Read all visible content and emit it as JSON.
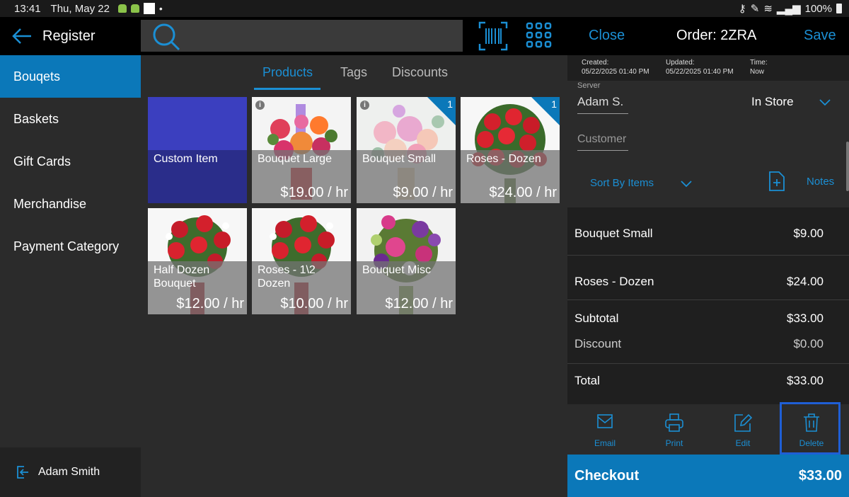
{
  "status": {
    "time": "13:41",
    "date": "Thu, May 22",
    "battery": "100%"
  },
  "header": {
    "back_label": "Register",
    "close": "Close",
    "order": "Order: 2ZRA",
    "save": "Save"
  },
  "sidebar": {
    "items": [
      {
        "label": "Bouqets"
      },
      {
        "label": "Baskets"
      },
      {
        "label": "Gift Cards"
      },
      {
        "label": "Merchandise"
      },
      {
        "label": "Payment Category"
      }
    ],
    "active_index": 0,
    "user": "Adam Smith"
  },
  "tabs": {
    "products": "Products",
    "tags": "Tags",
    "discounts": "Discounts"
  },
  "products": [
    {
      "name": "Custom Item",
      "price": ""
    },
    {
      "name": "Bouquet Large",
      "price": "$19.00 / hr",
      "info": "i"
    },
    {
      "name": "Bouquet Small",
      "price": "$9.00 / hr",
      "info": "i",
      "count": "1"
    },
    {
      "name": "Roses - Dozen",
      "price": "$24.00 / hr",
      "count": "1"
    },
    {
      "name": "Half Dozen Bouquet",
      "price": "$12.00 / hr"
    },
    {
      "name": "Roses - 1\\2 Dozen",
      "price": "$10.00 / hr"
    },
    {
      "name": "Bouquet Misc",
      "price": "$12.00 / hr"
    }
  ],
  "order": {
    "created_label": "Created:",
    "created": "05/22/2025 01:40 PM",
    "updated_label": "Updated:",
    "updated": "05/22/2025 01:40 PM",
    "time_label": "Time:",
    "time": "Now",
    "server_label": "Server",
    "server": "Adam S.",
    "type": "In Store",
    "customer_placeholder": "Customer",
    "sort": "Sort By Items",
    "notes": "Notes",
    "lines": [
      {
        "name": "Bouquet Small",
        "amount": "$9.00"
      },
      {
        "name": "Roses - Dozen",
        "amount": "$24.00"
      }
    ],
    "subtotal_label": "Subtotal",
    "subtotal": "$33.00",
    "discount_label": "Discount",
    "discount": "$0.00",
    "total_label": "Total",
    "total": "$33.00"
  },
  "actions": {
    "email": "Email",
    "print": "Print",
    "edit": "Edit",
    "delete": "Delete"
  },
  "checkout": {
    "label": "Checkout",
    "amount": "$33.00"
  },
  "colors": {
    "accent": "#1b8fd4",
    "active": "#0b78b9",
    "highlight": "#1f5fd6"
  }
}
